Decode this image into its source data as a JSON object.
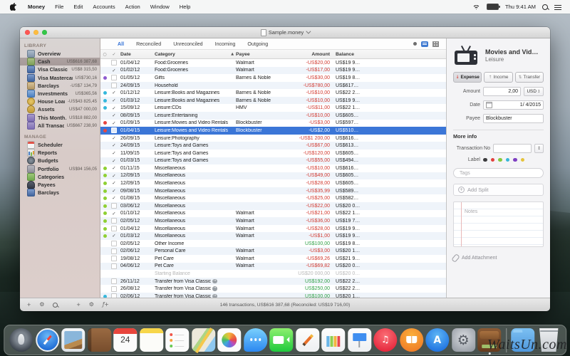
{
  "menu_bar": {
    "items": [
      "Money",
      "File",
      "Edit",
      "Accounts",
      "Action",
      "Window",
      "Help"
    ],
    "clock": "Thu 9:41 AM"
  },
  "window": {
    "title": "Sample.money"
  },
  "sidebar": {
    "library_header": "LIBRARY",
    "library": [
      {
        "icon": "overview-icon",
        "icon_class": "i-overview",
        "label": "Overview",
        "value": ""
      },
      {
        "icon": "cash-icon",
        "icon_class": "i-cash",
        "label": "Cash",
        "value": "US$616 387,68",
        "selected": true
      },
      {
        "icon": "visa-classic-icon",
        "icon_class": "i-visa-classic",
        "label": "Visa Classic",
        "value": "US$8 315,50"
      },
      {
        "icon": "visa-mastercard-icon",
        "icon_class": "i-visa-mastercard",
        "label": "Visa Mastercard",
        "value": "US$730,16"
      },
      {
        "icon": "bank-icon",
        "icon_class": "i-bank",
        "label": "Barclays",
        "value": "-US$7 134,79"
      },
      {
        "icon": "investments-icon",
        "icon_class": "i-investments",
        "label": "Investments",
        "value": "US$365,56"
      },
      {
        "icon": "coin-icon",
        "icon_class": "i-coin",
        "label": "House Loan",
        "value": "-US$43 825,45"
      },
      {
        "icon": "money-bag-icon",
        "icon_class": "i-bag",
        "label": "Assets",
        "value": "US$47 000,00"
      },
      {
        "icon": "smart-folder-icon",
        "icon_class": "i-folder",
        "label": "This Month…",
        "value": "US$18 882,00"
      },
      {
        "icon": "smart-folder-icon",
        "icon_class": "i-folder",
        "label": "All Transac…",
        "value": "US$667 238,90"
      }
    ],
    "manage_header": "MANAGE",
    "manage": [
      {
        "icon": "scheduler-icon",
        "icon_class": "i-calendar",
        "label": "Scheduler",
        "value": ""
      },
      {
        "icon": "reports-icon",
        "icon_class": "i-reports",
        "label": "Reports",
        "value": ""
      },
      {
        "icon": "budgets-icon",
        "icon_class": "i-budgets",
        "label": "Budgets",
        "value": ""
      },
      {
        "icon": "portfolio-icon",
        "icon_class": "i-portfolio",
        "label": "Portfolio",
        "value": "US$94 156,05"
      },
      {
        "icon": "categories-icon",
        "icon_class": "i-categories",
        "label": "Categories",
        "value": ""
      },
      {
        "icon": "payees-icon",
        "icon_class": "i-payees",
        "label": "Payees",
        "value": ""
      },
      {
        "icon": "card-icon",
        "icon_class": "i-barclays-card",
        "label": "Barclays",
        "value": ""
      }
    ]
  },
  "tabs": [
    "All",
    "Reconciled",
    "Unreconciled",
    "Incoming",
    "Outgoing"
  ],
  "active_tab": 0,
  "table": {
    "header": {
      "status": "○",
      "check": "✓",
      "date": "Date",
      "category": "Category",
      "sort_arrow": "▲",
      "payee": "Payee",
      "amount": "Amount",
      "balance": "Balance"
    },
    "rows": [
      {
        "dot": null,
        "chk": false,
        "date": "01/04/12",
        "cat": "Food:Groceries",
        "payee": "Walmart",
        "amt": "-US$20,00",
        "t": "neg",
        "bal": "US$19 9…"
      },
      {
        "dot": null,
        "chk": true,
        "date": "01/02/12",
        "cat": "Food:Groceries",
        "payee": "Walmart",
        "amt": "-US$17,00",
        "t": "neg",
        "bal": "US$19 9…"
      },
      {
        "dot": "purple",
        "chk": false,
        "date": "01/05/12",
        "cat": "Gifts",
        "payee": "Barnes & Noble",
        "amt": "-US$30,00",
        "t": "neg",
        "bal": "US$19 8…"
      },
      {
        "dot": null,
        "chk": false,
        "date": "24/09/15",
        "cat": "Household",
        "payee": "",
        "amt": "-US$780,00",
        "t": "neg",
        "bal": "US$617…"
      },
      {
        "dot": "cyan",
        "chk": true,
        "date": "01/12/12",
        "cat": "Leisure:Books and Magazines",
        "payee": "Barnes & Noble",
        "amt": "-US$10,00",
        "t": "neg",
        "bal": "US$22 2…"
      },
      {
        "dot": "cyan",
        "chk": true,
        "date": "01/03/12",
        "cat": "Leisure:Books and Magazines",
        "payee": "Barnes & Noble",
        "amt": "-US$10,00",
        "t": "neg",
        "bal": "US$19 9…"
      },
      {
        "dot": "cyan",
        "chk": true,
        "date": "15/09/12",
        "cat": "Leisure:CDs",
        "payee": "HMV",
        "amt": "-US$11,00",
        "t": "neg",
        "bal": "US$22 1…"
      },
      {
        "dot": null,
        "chk": true,
        "date": "08/09/15",
        "cat": "Leisure:Entertaining",
        "payee": "",
        "amt": "-US$10,00",
        "t": "neg",
        "bal": "US$605…"
      },
      {
        "dot": "red",
        "chk": true,
        "date": "01/09/15",
        "cat": "Leisure:Movies and Video Rentals",
        "payee": "Blockbuster",
        "amt": "-US$3,00",
        "t": "neg",
        "bal": "US$597…"
      },
      {
        "dot": "red",
        "chk": false,
        "date": "01/04/15",
        "cat": "Leisure:Movies and Video Rentals",
        "payee": "Blockbuster",
        "amt": "-US$2,00",
        "t": "neg",
        "bal": "US$510…",
        "selected": true
      },
      {
        "dot": null,
        "chk": true,
        "date": "26/09/15",
        "cat": "Leisure:Photography",
        "payee": "",
        "amt": "-US$1 200,00",
        "t": "neg",
        "bal": "US$616…"
      },
      {
        "dot": null,
        "chk": true,
        "date": "24/09/15",
        "cat": "Leisure:Toys and Games",
        "payee": "",
        "amt": "-US$67,00",
        "t": "neg",
        "bal": "US$613…"
      },
      {
        "dot": null,
        "chk": true,
        "date": "11/09/15",
        "cat": "Leisure:Toys and Games",
        "payee": "",
        "amt": "-US$120,00",
        "t": "neg",
        "bal": "US$605…"
      },
      {
        "dot": null,
        "chk": true,
        "date": "01/03/15",
        "cat": "Leisure:Toys and Games",
        "payee": "",
        "amt": "-US$55,00",
        "t": "neg",
        "bal": "US$494…"
      },
      {
        "dot": "green",
        "chk": true,
        "date": "01/11/15",
        "cat": "Miscellaneous",
        "payee": "",
        "amt": "-US$10,00",
        "t": "neg",
        "bal": "US$616…"
      },
      {
        "dot": "green",
        "chk": true,
        "date": "12/09/15",
        "cat": "Miscellaneous",
        "payee": "",
        "amt": "-US$49,00",
        "t": "neg",
        "bal": "US$605…"
      },
      {
        "dot": "green",
        "chk": true,
        "date": "12/09/15",
        "cat": "Miscellaneous",
        "payee": "",
        "amt": "-US$28,00",
        "t": "neg",
        "bal": "US$605…"
      },
      {
        "dot": "green",
        "chk": true,
        "date": "09/08/15",
        "cat": "Miscellaneous",
        "payee": "",
        "amt": "-US$35,99",
        "t": "neg",
        "bal": "US$589…"
      },
      {
        "dot": "green",
        "chk": true,
        "date": "01/08/15",
        "cat": "Miscellaneous",
        "payee": "",
        "amt": "-US$25,00",
        "t": "neg",
        "bal": "US$582…"
      },
      {
        "dot": "green",
        "chk": false,
        "date": "03/06/12",
        "cat": "Miscellaneous",
        "payee": "",
        "amt": "-US$22,00",
        "t": "neg",
        "bal": "US$20 0…"
      },
      {
        "dot": "green",
        "chk": true,
        "date": "01/10/12",
        "cat": "Miscellaneous",
        "payee": "Walmart",
        "amt": "-US$21,00",
        "t": "neg",
        "bal": "US$22 1…"
      },
      {
        "dot": "green",
        "chk": false,
        "date": "02/05/12",
        "cat": "Miscellaneous",
        "payee": "Walmart",
        "amt": "-US$36,00",
        "t": "neg",
        "bal": "US$19 7…"
      },
      {
        "dot": "green",
        "chk": false,
        "date": "01/04/12",
        "cat": "Miscellaneous",
        "payee": "Walmart",
        "amt": "-US$28,00",
        "t": "neg",
        "bal": "US$19 9…"
      },
      {
        "dot": "green",
        "chk": true,
        "date": "01/03/12",
        "cat": "Miscellaneous",
        "payee": "Walmart",
        "amt": "-US$1,00",
        "t": "neg",
        "bal": "US$19 9…"
      },
      {
        "dot": null,
        "chk": false,
        "date": "02/05/12",
        "cat": "Other Income",
        "payee": "",
        "amt": "US$100,00",
        "t": "pos",
        "bal": "US$19 8…"
      },
      {
        "dot": null,
        "chk": false,
        "date": "02/06/12",
        "cat": "Personal Care",
        "payee": "Walmart",
        "amt": "-US$3,00",
        "t": "neg",
        "bal": "US$20 1…"
      },
      {
        "dot": null,
        "chk": false,
        "date": "19/08/12",
        "cat": "Pet Care",
        "payee": "Walmart",
        "amt": "-US$69,26",
        "t": "neg",
        "bal": "US$21 9…"
      },
      {
        "dot": null,
        "chk": false,
        "date": "04/06/12",
        "cat": "Pet Care",
        "payee": "Walmart",
        "amt": "-US$69,82",
        "t": "neg",
        "bal": "US$20 0…"
      },
      {
        "dot": null,
        "chk": null,
        "date": "",
        "cat": "Starting Balance",
        "payee": "",
        "amt": "US$20 000,00",
        "t": "muted",
        "bal": "US$20 0…",
        "muted": true
      },
      {
        "dot": null,
        "chk": false,
        "date": "26/11/12",
        "cat": "Transfer from Visa Classic",
        "transfer": true,
        "payee": "",
        "amt": "US$192,00",
        "t": "pos",
        "bal": "US$22 2…"
      },
      {
        "dot": null,
        "chk": false,
        "date": "26/08/12",
        "cat": "Transfer from Visa Classic",
        "transfer": true,
        "payee": "",
        "amt": "US$250,00",
        "t": "pos",
        "bal": "US$22 2…"
      },
      {
        "dot": "cyan",
        "chk": false,
        "date": "02/06/12",
        "cat": "Transfer from Visa Classic",
        "transfer": true,
        "payee": "",
        "amt": "US$100,00",
        "t": "pos",
        "bal": "US$20 1…"
      }
    ]
  },
  "status_bar": {
    "summary": "146 transactions, US$616 387,68 (Reconciled: US$19 716,00)",
    "add_label": "+",
    "action_label": "ƒ+"
  },
  "inspector": {
    "title": "Movies and Vid…",
    "subtitle": "Leisure",
    "type_buttons": {
      "expense": "Expense",
      "income": "Income",
      "transfer": "Transfer"
    },
    "amount_label": "Amount",
    "amount_value": "2,00",
    "currency": "USD",
    "date_label": "Date",
    "date_value": "1/ 4/2015",
    "payee_label": "Payee",
    "payee_value": "Blockbuster",
    "more_info": "More info",
    "transaction_no_label": "Transaction No",
    "label_label": "Label",
    "label_colors": [
      "#3b3b3d",
      "#e2403c",
      "#86ca3e",
      "#36b6d9",
      "#7e3fc2",
      "#e5c33c"
    ],
    "tags_placeholder": "Tags",
    "add_split": "Add Split",
    "notes_placeholder": "Notes",
    "add_attachment": "Add Attachment"
  },
  "dock": {
    "apps": [
      "launchpad",
      "safari",
      "preview",
      "contacts",
      "calendar",
      "notes",
      "reminders",
      "maps",
      "photos",
      "messages",
      "facetime",
      "pages",
      "numbers",
      "keynote",
      "itunes",
      "ibooks",
      "app-store",
      "system-preferences",
      "money"
    ],
    "right_items": [
      "downloads",
      "trash"
    ],
    "calendar_day": "24",
    "running_app": "money"
  },
  "watermark": "WaitsUn.com",
  "colors": {
    "selection_blue": "#3b76d7",
    "negative_red": "#d23a30",
    "positive_green": "#2fa045",
    "tab_active_blue": "#2f6fd6"
  }
}
